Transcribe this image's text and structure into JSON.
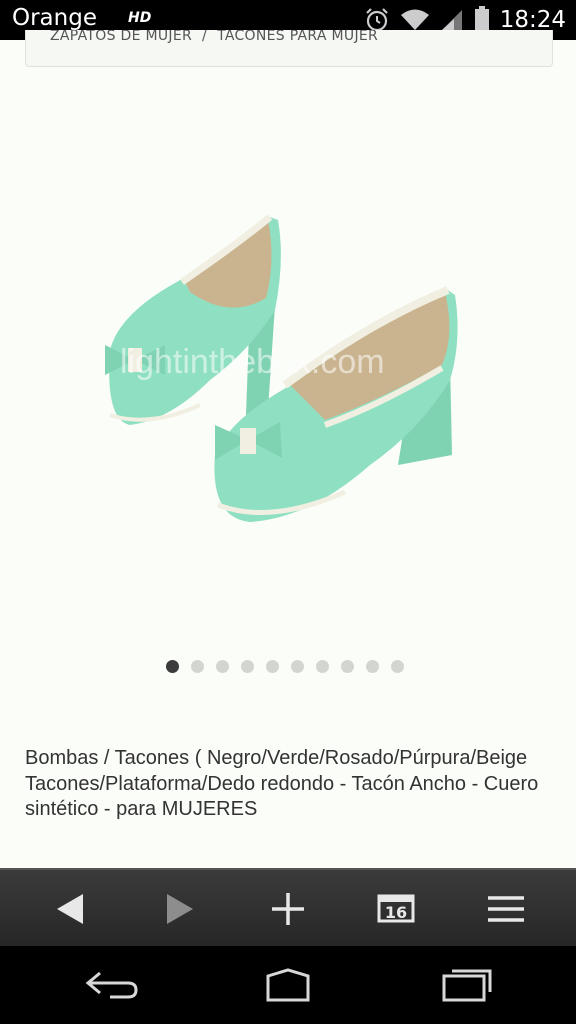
{
  "status_bar": {
    "carrier": "Orange",
    "network_badge": "HD",
    "time": "18:24",
    "icons": [
      "alarm-icon",
      "wifi-icon",
      "cell-signal-icon",
      "battery-icon"
    ]
  },
  "breadcrumb": {
    "items": [
      "ZAPATOS DE MUJER",
      "TACONES PARA MUJER"
    ],
    "separator": "/"
  },
  "product": {
    "image_alt": "mint green bow platform heels",
    "watermark": "lightinthebox.com",
    "carousel": {
      "total": 10,
      "active_index": 0
    },
    "title": "Bombas / Tacones ( Negro/Verde/Rosado/Púrpura/Beige Tacones/Plataforma/Dedo redondo - Tacón Ancho - Cuero sintético - para MUJERES",
    "colors": {
      "shoe": "#8fe0c2",
      "trim": "#f1efe2",
      "insole": "#c9b48f"
    }
  },
  "toolbar": {
    "tab_count": "16",
    "buttons": [
      "back-icon",
      "forward-icon",
      "new-tab-icon",
      "tabs-icon",
      "menu-icon"
    ]
  },
  "nav_bar": {
    "buttons": [
      "back-icon",
      "home-icon",
      "recents-icon"
    ]
  }
}
